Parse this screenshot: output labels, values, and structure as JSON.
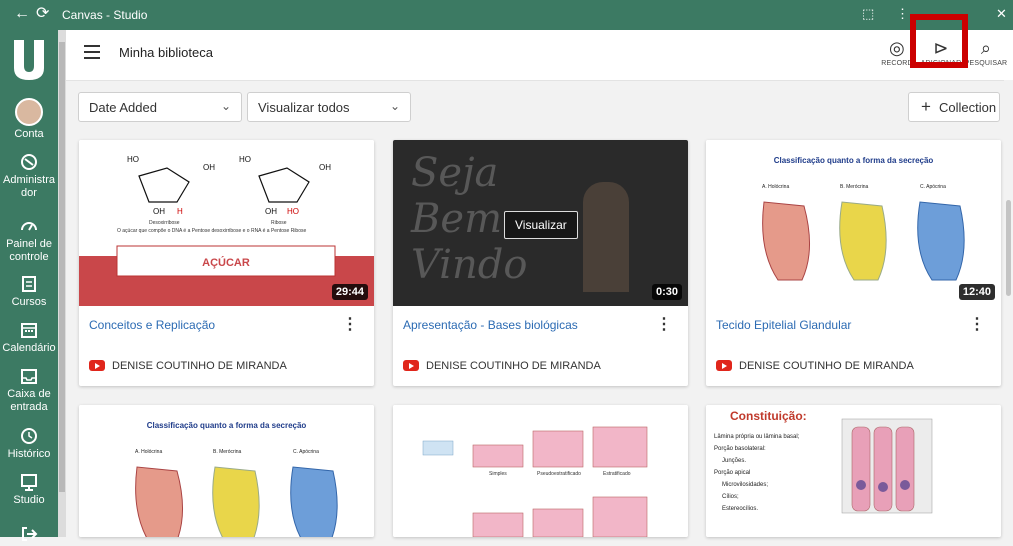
{
  "window": {
    "title": "Canvas - Studio"
  },
  "sidebar": {
    "items": [
      {
        "label": "Conta",
        "icon": "account-avatar"
      },
      {
        "label": "Administrador",
        "icon": "shield-icon"
      },
      {
        "label": "Painel de controle",
        "icon": "dashboard-icon"
      },
      {
        "label": "Cursos",
        "icon": "courses-icon"
      },
      {
        "label": "Calendário",
        "icon": "calendar-icon"
      },
      {
        "label": "Caixa de entrada",
        "icon": "inbox-icon"
      },
      {
        "label": "Histórico",
        "icon": "history-icon"
      },
      {
        "label": "Studio",
        "icon": "studio-icon"
      }
    ]
  },
  "header": {
    "title": "Minha biblioteca",
    "tools": [
      {
        "label": "RECORD",
        "icon": "record-icon"
      },
      {
        "label": "ADICIONAR",
        "icon": "add-media-icon"
      },
      {
        "label": "PESQUISAR",
        "icon": "search-icon"
      }
    ]
  },
  "filters": {
    "sort": {
      "value": "Date Added"
    },
    "view": {
      "value": "Visualizar todos"
    },
    "collection_button": "Collection"
  },
  "cards": [
    {
      "thumb_caption": "AÇÚCAR",
      "thumb_text": "O açúcar que compõe o DNA é a Pentose desoxirribose e o RNA é a Pentose Ribose",
      "labels": [
        "Desoxirribose",
        "Ribose"
      ],
      "duration": "29:44",
      "title": "Conceitos e Replicação",
      "owner": "DENISE COUTINHO DE MIRANDA"
    },
    {
      "overlay_button": "Visualizar",
      "script_text": "Seja Bem Vindo",
      "duration": "0:30",
      "title": "Apresentação - Bases biológicas",
      "owner": "DENISE COUTINHO DE MIRANDA"
    },
    {
      "thumb_title": "Classificação quanto a forma da secreção",
      "labels": [
        "A. Holócrina",
        "B. Merócrina",
        "C. Apócrina"
      ],
      "duration": "12:40",
      "title": "Tecido Epitelial Glandular",
      "owner": "DENISE COUTINHO DE MIRANDA"
    },
    {
      "thumb_title": "Classificação quanto a forma da secreção",
      "labels": [
        "A. Holócrina",
        "B. Merócrina",
        "C. Apócrina"
      ]
    },
    {
      "labels": [
        "Simples",
        "Pseudoestratificado",
        "Estratificado"
      ]
    },
    {
      "thumb_title": "Constituição:",
      "bullets": [
        "Lâmina própria ou lâmina basal;",
        "Porção basolateral:",
        "Junções.",
        "Porção apical",
        "Microvilosidades;",
        "Cílios;",
        "Estereocílios."
      ]
    }
  ],
  "colors": {
    "brand_green": "#3c7a63",
    "link_blue": "#2c6bb3",
    "highlight_red": "#cc0000",
    "youtube_red": "#e0261b"
  }
}
